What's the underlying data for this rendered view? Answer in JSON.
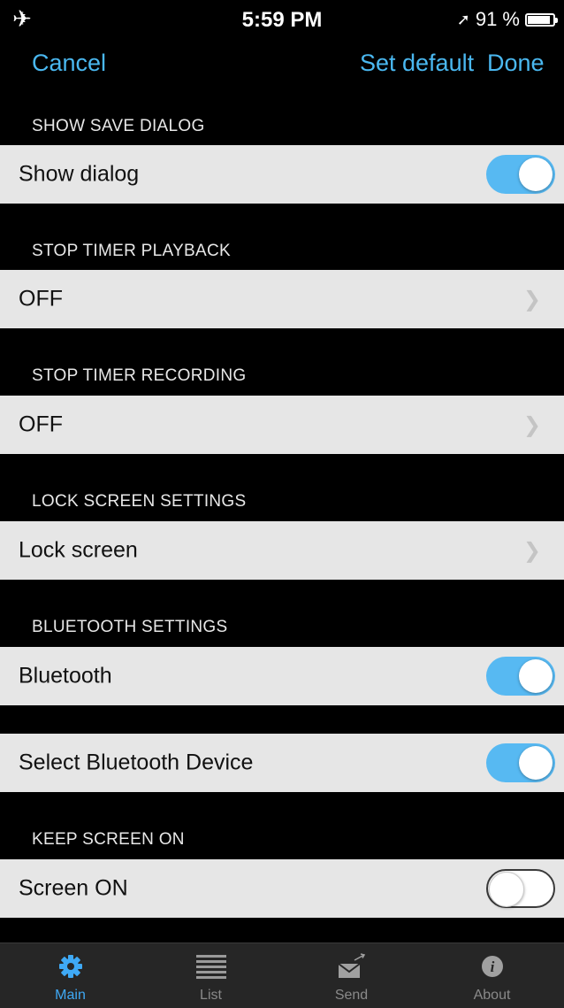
{
  "status_bar": {
    "time": "5:59 PM",
    "battery_text": "91 %",
    "battery_level": 0.91
  },
  "nav": {
    "cancel": "Cancel",
    "set_default": "Set default",
    "done": "Done"
  },
  "sections": {
    "save_dialog": {
      "header": "SHOW SAVE DIALOG",
      "row_label": "Show dialog",
      "toggle_on": true
    },
    "stop_playback": {
      "header": "STOP TIMER PLAYBACK",
      "row_label": "OFF"
    },
    "stop_recording": {
      "header": "STOP TIMER RECORDING",
      "row_label": "OFF"
    },
    "lock_screen": {
      "header": "LOCK SCREEN SETTINGS",
      "row_label": "Lock screen"
    },
    "bluetooth": {
      "header": "BLUETOOTH SETTINGS",
      "row_label": "Bluetooth",
      "toggle_on": true
    },
    "bluetooth_device": {
      "row_label": "Select Bluetooth Device",
      "toggle_on": true
    },
    "keep_screen": {
      "header": "KEEP SCREEN ON",
      "row_label": "Screen ON",
      "toggle_on": false
    }
  },
  "tabs": [
    {
      "label": "Main",
      "icon": "gear-icon",
      "active": true
    },
    {
      "label": "List",
      "icon": "list-icon",
      "active": false
    },
    {
      "label": "Send",
      "icon": "envelope-icon",
      "active": false
    },
    {
      "label": "About",
      "icon": "info-icon",
      "active": false
    }
  ],
  "colors": {
    "accent": "#4ab8f0",
    "toggle_on": "#57b9f2",
    "row_bg": "#e6e6e6",
    "background": "#000000",
    "tab_bar": "#262626"
  }
}
